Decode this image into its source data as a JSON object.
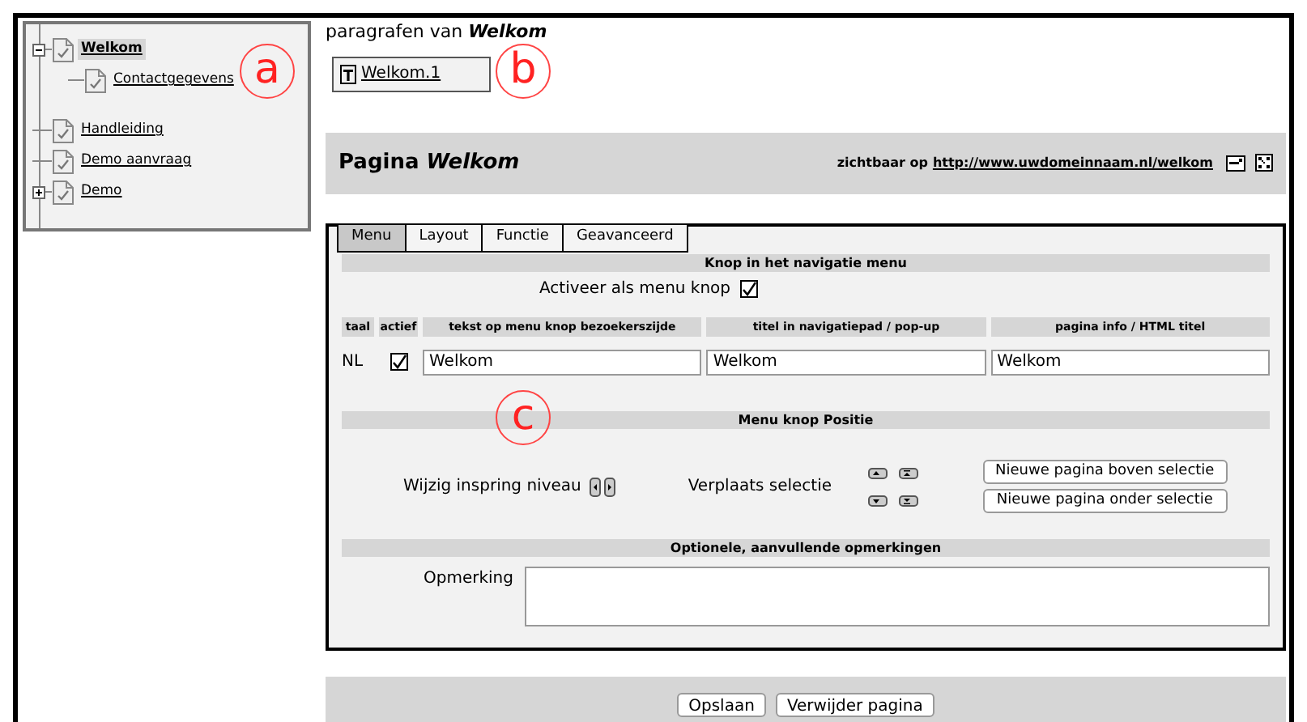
{
  "tree": [
    {
      "label": "Welkom",
      "selected": true,
      "expanded": true,
      "children": [
        {
          "label": "Contactgegevens",
          "selected": false
        }
      ]
    },
    {
      "label": "Handleiding",
      "selected": false
    },
    {
      "label": "Demo aanvraag",
      "selected": false
    },
    {
      "label": "Demo",
      "selected": false,
      "expanded": false
    }
  ],
  "paragraphs": {
    "label": "paragrafen van",
    "page": "Welkom",
    "items": [
      "Welkom.1"
    ]
  },
  "page_header": {
    "label": "Pagina",
    "page": "Welkom",
    "visible_label": "zichtbaar op",
    "url": "http://www.uwdomeinnaam.nl/welkom"
  },
  "tabs": [
    {
      "label": "Menu",
      "selected": true
    },
    {
      "label": "Layout",
      "selected": false
    },
    {
      "label": "Functie",
      "selected": false
    },
    {
      "label": "Geavanceerd",
      "selected": false
    }
  ],
  "menu_section": {
    "title": "Knop in het navigatie menu",
    "activate_label": "Activeer als menu knop",
    "activate_checked": true,
    "columns": [
      "taal",
      "actief",
      "tekst op menu knop bezoekerszijde",
      "titel in navigatiepad / pop-up",
      "pagina info / HTML titel"
    ],
    "rows": [
      {
        "lang": "NL",
        "active": true,
        "values": [
          "Welkom",
          "Welkom",
          "Welkom"
        ]
      }
    ]
  },
  "position_section": {
    "title": "Menu knop Positie",
    "indent_label": "Wijzig inspring niveau",
    "move_label": "Verplaats selectie",
    "buttons": [
      "Nieuwe pagina boven selectie",
      "Nieuwe pagina onder selectie"
    ]
  },
  "remarks_section": {
    "title": "Optionele, aanvullende opmerkingen",
    "label": "Opmerking"
  },
  "footer_buttons": [
    "Opslaan",
    "Verwijder pagina"
  ],
  "callouts": [
    "a",
    "b",
    "c"
  ]
}
